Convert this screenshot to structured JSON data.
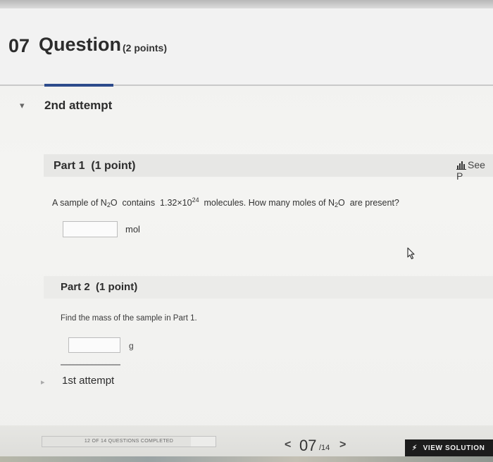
{
  "question": {
    "number": "07",
    "title": "Question",
    "points": "(2 points)"
  },
  "attempts": {
    "current": "2nd attempt",
    "previous": "1st attempt"
  },
  "part1": {
    "title": "Part 1",
    "points": "(1 point)",
    "see_label": "See P",
    "question_prefix": "A sample of N",
    "question_sub1": "2",
    "question_mid1": "O  contains  1.32×10",
    "question_sup": "24",
    "question_mid2": "  molecules. How many moles of N",
    "question_sub2": "2",
    "question_suffix": "O  are present?",
    "answer_value": "",
    "unit": "mol"
  },
  "part2": {
    "title": "Part 2",
    "points": "(1 point)",
    "question": "Find the mass of the sample in Part 1.",
    "answer_value": "",
    "unit": "g"
  },
  "footer": {
    "progress_label": "12 OF 14 QUESTIONS COMPLETED",
    "progress_fraction": 0.857,
    "current_page": "07",
    "total_pages": "/14",
    "view_solution_label": "VIEW SOLUTION"
  },
  "icons": {
    "chevron": "chevron-down-icon",
    "chart": "bar-chart-icon",
    "prev": "chevron-left-icon",
    "next": "chevron-right-icon",
    "bolt": "lightning-icon",
    "cursor": "mouse-pointer-icon"
  }
}
